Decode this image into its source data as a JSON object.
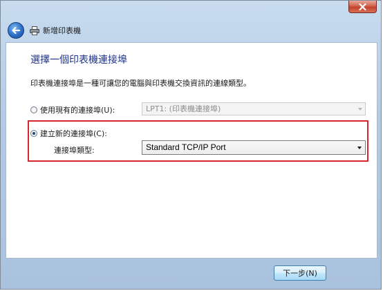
{
  "window": {
    "title": "新增印表機",
    "close_label": "close"
  },
  "page": {
    "heading": "選擇一個印表機連接埠",
    "description": "印表機連接埠是一種可讓您的電腦與印表機交換資訊的連線類型。"
  },
  "options": {
    "use_existing": {
      "label": "使用現有的連接埠(U):",
      "selected": false,
      "value": "LPT1: (印表機連接埠)"
    },
    "create_new": {
      "label": "建立新的連接埠(C):",
      "selected": true,
      "type_label": "連接埠類型:",
      "type_value": "Standard TCP/IP Port"
    }
  },
  "footer": {
    "next_label": "下一步(N)"
  },
  "colors": {
    "heading": "#1e3287",
    "highlight": "#d7262e"
  },
  "icons": {
    "back": "back-arrow-icon",
    "printer": "printer-icon",
    "close": "close-icon"
  }
}
